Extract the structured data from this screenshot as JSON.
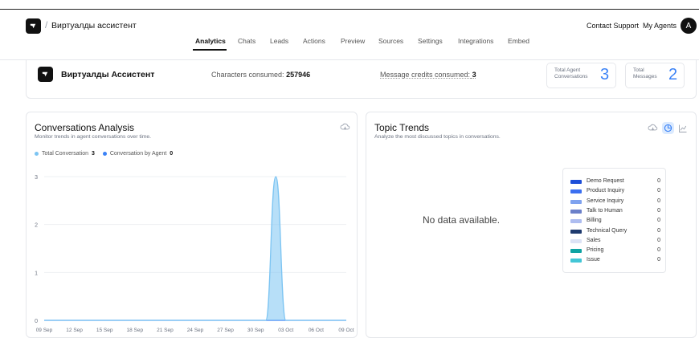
{
  "header": {
    "app_title": "Виртуалды ассистент",
    "separator": "/",
    "contact_support": "Contact Support",
    "my_agents": "My Agents",
    "avatar_initial": "A"
  },
  "tabs": [
    {
      "label": "Analytics",
      "active": true
    },
    {
      "label": "Chats"
    },
    {
      "label": "Leads"
    },
    {
      "label": "Actions"
    },
    {
      "label": "Preview"
    },
    {
      "label": "Sources"
    },
    {
      "label": "Settings"
    },
    {
      "label": "Integrations"
    },
    {
      "label": "Embed"
    }
  ],
  "summary": {
    "agent_name": "Виртуалды Ассистент",
    "characters_label": "Characters consumed:",
    "characters_value": "257946",
    "credits_label": "Message credits consumed:",
    "credits_value": "3",
    "total_agent_conversations_label_1": "Total Agent",
    "total_agent_conversations_label_2": "Conversations",
    "total_agent_conversations_value": "3",
    "total_messages_label_1": "Total",
    "total_messages_label_2": "Messages",
    "total_messages_value": "2"
  },
  "conversations_card": {
    "title": "Conversations Analysis",
    "subtitle": "Monitor trends in agent conversations over time.",
    "legend_total_label": "Total Conversation",
    "legend_total_value": "3",
    "legend_agent_label": "Conversation by Agent",
    "legend_agent_value": "0",
    "icons": [
      "download-icon"
    ]
  },
  "chart_data": {
    "type": "area",
    "categories": [
      "09 Sep",
      "12 Sep",
      "15 Sep",
      "18 Sep",
      "21 Sep",
      "24 Sep",
      "27 Sep",
      "30 Sep",
      "03 Oct",
      "06 Oct",
      "09 Oct"
    ],
    "x": [
      "09 Sep",
      "10 Sep",
      "11 Sep",
      "12 Sep",
      "13 Sep",
      "14 Sep",
      "15 Sep",
      "16 Sep",
      "17 Sep",
      "18 Sep",
      "19 Sep",
      "20 Sep",
      "21 Sep",
      "22 Sep",
      "23 Sep",
      "24 Sep",
      "25 Sep",
      "26 Sep",
      "27 Sep",
      "28 Sep",
      "29 Sep",
      "30 Sep",
      "01 Oct",
      "02 Oct",
      "03 Oct",
      "04 Oct",
      "05 Oct",
      "06 Oct",
      "07 Oct",
      "08 Oct",
      "09 Oct"
    ],
    "series": [
      {
        "name": "Total Conversation",
        "color": "#7cc4f2",
        "values": [
          0,
          0,
          0,
          0,
          0,
          0,
          0,
          0,
          0,
          0,
          0,
          0,
          0,
          0,
          0,
          0,
          0,
          0,
          0,
          0,
          0,
          0,
          0,
          3,
          0,
          0,
          0,
          0,
          0,
          0,
          0
        ]
      },
      {
        "name": "Conversation by Agent",
        "color": "#3b82f6",
        "values": [
          0,
          0,
          0,
          0,
          0,
          0,
          0,
          0,
          0,
          0,
          0,
          0,
          0,
          0,
          0,
          0,
          0,
          0,
          0,
          0,
          0,
          0,
          0,
          0,
          0,
          0,
          0,
          0,
          0,
          0,
          0
        ]
      }
    ],
    "ylim": [
      0,
      3
    ],
    "yticks": [
      0,
      1,
      2,
      3
    ],
    "grid": true
  },
  "topic_card": {
    "title": "Topic Trends",
    "subtitle": "Analyze the most discussed topics in conversations.",
    "no_data": "No data available.",
    "icons": [
      "download-icon",
      "pie-chart-icon",
      "line-chart-icon"
    ],
    "legend": [
      {
        "label": "Demo Request",
        "value": "0",
        "color": "#1d4ed8"
      },
      {
        "label": "Product Inquiry",
        "value": "0",
        "color": "#3b6ff0"
      },
      {
        "label": "Service Inquiry",
        "value": "0",
        "color": "#7fa2ef"
      },
      {
        "label": "Talk to Human",
        "value": "0",
        "color": "#6b80c9"
      },
      {
        "label": "Billing",
        "value": "0",
        "color": "#aebdf0"
      },
      {
        "label": "Technical Query",
        "value": "0",
        "color": "#1e3a6e"
      },
      {
        "label": "Sales",
        "value": "0",
        "color": "#dde3f5"
      },
      {
        "label": "Pricing",
        "value": "0",
        "color": "#0fa3a3"
      },
      {
        "label": "Issue",
        "value": "0",
        "color": "#43c6d6"
      }
    ]
  }
}
